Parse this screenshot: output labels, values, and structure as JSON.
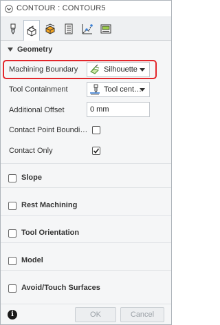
{
  "window": {
    "title": "CONTOUR : CONTOUR5"
  },
  "tabs": [
    {
      "icon": "tool-icon",
      "active": false
    },
    {
      "icon": "geometry-icon",
      "active": true
    },
    {
      "icon": "heights-icon",
      "active": false
    },
    {
      "icon": "passes-icon",
      "active": false
    },
    {
      "icon": "linking-icon",
      "active": false
    },
    {
      "icon": "post-process-icon",
      "active": false
    }
  ],
  "geometry": {
    "header": "Geometry",
    "machining_boundary": {
      "label": "Machining Boundary",
      "value": "Silhouette",
      "icon": "silhouette-icon"
    },
    "tool_containment": {
      "label": "Tool Containment",
      "value": "Tool cent…",
      "icon": "tool-center-icon"
    },
    "additional_offset": {
      "label": "Additional Offset",
      "value": "0 mm"
    },
    "contact_point_boundary": {
      "label": "Contact Point Boundi…",
      "checked": false
    },
    "contact_only": {
      "label": "Contact Only",
      "checked": true
    }
  },
  "sections": [
    {
      "label": "Slope",
      "checked": false
    },
    {
      "label": "Rest Machining",
      "checked": false
    },
    {
      "label": "Tool Orientation",
      "checked": false
    },
    {
      "label": "Model",
      "checked": false
    },
    {
      "label": "Avoid/Touch Surfaces",
      "checked": false
    }
  ],
  "footer": {
    "ok_label": "OK",
    "cancel_label": "Cancel",
    "info_icon": "info-icon"
  },
  "colors": {
    "highlight": "#e3262b",
    "accent": "#0696d7"
  }
}
